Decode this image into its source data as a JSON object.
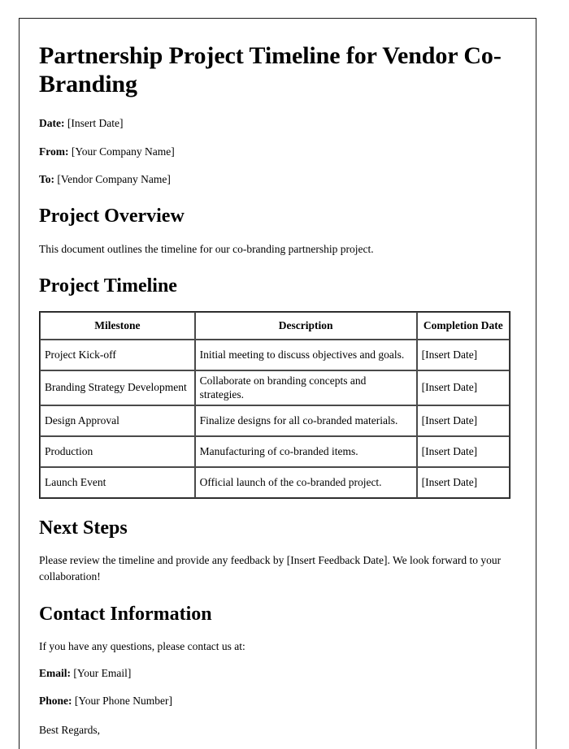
{
  "document": {
    "title": "Partnership Project Timeline for Vendor Co-Branding",
    "meta": {
      "date_label": "Date:",
      "date_value": "[Insert Date]",
      "from_label": "From:",
      "from_value": "[Your Company Name]",
      "to_label": "To:",
      "to_value": "[Vendor Company Name]"
    },
    "overview": {
      "heading": "Project Overview",
      "text": "This document outlines the timeline for our co-branding partnership project."
    },
    "timeline": {
      "heading": "Project Timeline",
      "columns": [
        "Milestone",
        "Description",
        "Completion Date"
      ],
      "rows": [
        {
          "milestone": "Project Kick-off",
          "description": "Initial meeting to discuss objectives and goals.",
          "completion_date": "[Insert Date]"
        },
        {
          "milestone": "Branding Strategy Development",
          "description": "Collaborate on branding concepts and strategies.",
          "completion_date": "[Insert Date]"
        },
        {
          "milestone": "Design Approval",
          "description": "Finalize designs for all co-branded materials.",
          "completion_date": "[Insert Date]"
        },
        {
          "milestone": "Production",
          "description": "Manufacturing of co-branded items.",
          "completion_date": "[Insert Date]"
        },
        {
          "milestone": "Launch Event",
          "description": "Official launch of the co-branded project.",
          "completion_date": "[Insert Date]"
        }
      ]
    },
    "next_steps": {
      "heading": "Next Steps",
      "text": "Please review the timeline and provide any feedback by [Insert Feedback Date]. We look forward to your collaboration!"
    },
    "contact": {
      "heading": "Contact Information",
      "intro": "If you have any questions, please contact us at:",
      "email_label": "Email:",
      "email_value": "[Your Email]",
      "phone_label": "Phone:",
      "phone_value": "[Your Phone Number]"
    },
    "closing": "Best Regards,"
  }
}
